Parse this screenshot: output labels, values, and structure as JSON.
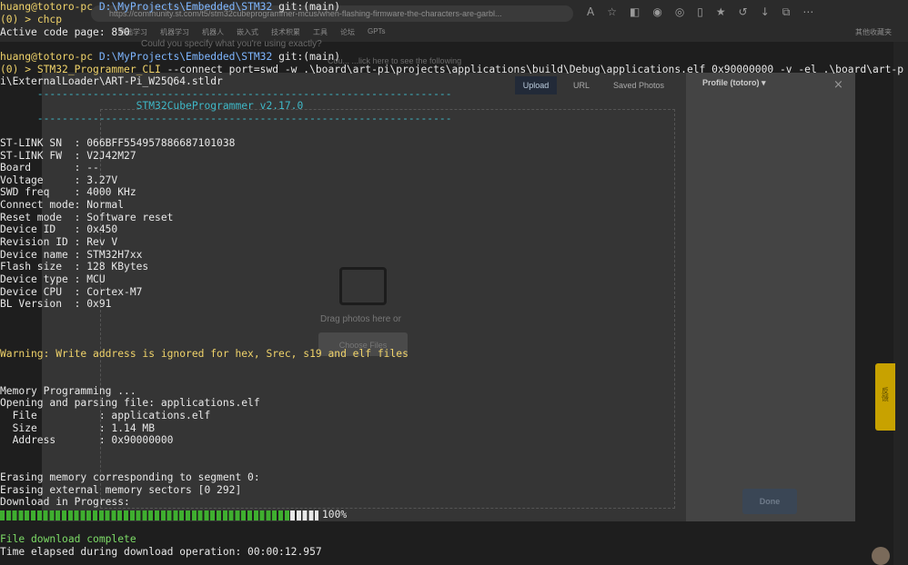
{
  "browser": {
    "url": "https://community.st.com/t5/stm32cubeprogrammer-mcus/when-flashing-firmware-the-characters-are-garbl...",
    "bookmarks": [
      "基础学习",
      "机器学习",
      "机器人",
      "嵌入式",
      "技术积累",
      "工具",
      "论坛",
      "GPTs"
    ],
    "other_bookmarks": "其他收藏夹",
    "question_text": "Could you specify what you're using exactly?",
    "reply_text": "Cou... ...lick here to see the following"
  },
  "upload_modal": {
    "tab_upload": "Upload",
    "tab_url": "URL",
    "tab_saved": "Saved Photos",
    "profile": "Profile (totoro)",
    "drag_text": "Drag photos here or",
    "choose_label": "Choose Files",
    "done_label": "Done",
    "side_tab": "反馈"
  },
  "terminal": {
    "prompt1": {
      "user": "huang@totoro-pc",
      "path": "D:\\MyProjects\\Embedded\\STM32",
      "branch": "git:(main)"
    },
    "cmd1_arrow": "(0) > ",
    "cmd1": "chcp",
    "cmd1_out": "Active code page: 850",
    "prompt2": {
      "user": "huang@totoro-pc",
      "path": "D:\\MyProjects\\Embedded\\STM32",
      "branch": "git:(main)"
    },
    "cmd2_arrow": "(0) > ",
    "cmd2_name": "STM32_Programmer_CLI",
    "cmd2_args": " --connect port=swd -w .\\board\\art-pi\\projects\\applications\\build\\Debug\\applications.elf 0x90000000 -v -el .\\board\\art-p",
    "cmd2_wrap": "i\\ExternalLoader\\ART-Pi_W25Q64.stldr",
    "separator": "      -------------------------------------------------------------------",
    "banner": "                      STM32CubeProgrammer v2.17.0",
    "info": [
      "ST-LINK SN  : 066BFF554957886687101038",
      "ST-LINK FW  : V2J42M27",
      "Board       : --",
      "Voltage     : 3.27V",
      "SWD freq    : 4000 KHz",
      "Connect mode: Normal",
      "Reset mode  : Software reset",
      "Device ID   : 0x450",
      "Revision ID : Rev V",
      "Device name : STM32H7xx",
      "Flash size  : 128 KBytes",
      "Device type : MCU",
      "Device CPU  : Cortex-M7",
      "BL Version  : 0x91"
    ],
    "warning": "Warning: Write address is ignored for hex, Srec, s19 and elf files",
    "programming": [
      "Memory Programming ...",
      "Opening and parsing file: applications.elf",
      "  File          : applications.elf",
      "  Size          : 1.14 MB",
      "  Address       : 0x90000000"
    ],
    "erase": [
      "Erasing memory corresponding to segment 0:",
      "Erasing external memory sectors [0 292]",
      "Download in Progress:"
    ],
    "progress_fraction": 1.0,
    "progress_label": "100%",
    "complete": "File download complete",
    "elapsed": "Time elapsed during download operation: 00:00:12.957"
  }
}
